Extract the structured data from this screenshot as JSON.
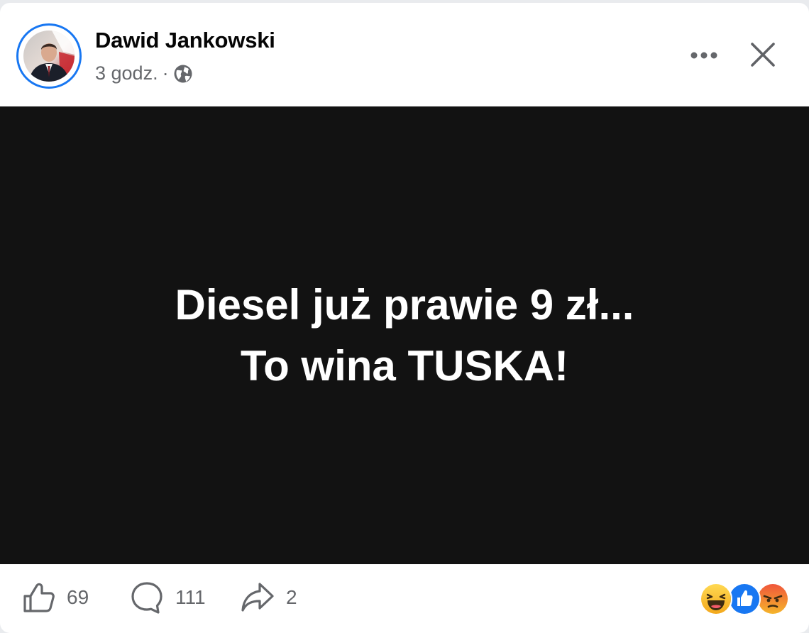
{
  "post": {
    "author_name": "Dawid Jankowski",
    "time": "3 godz.",
    "separator": "·",
    "visibility_icon": "globe-icon",
    "more_icon": "more-options-icon",
    "close_icon": "close-icon"
  },
  "media": {
    "line1": "Diesel już prawie 9 zł...",
    "line2": "To wina TUSKA!",
    "background": "#121212",
    "text_color": "#ffffff"
  },
  "actions": {
    "like": {
      "icon": "like-icon",
      "count": "69"
    },
    "comment": {
      "icon": "comment-icon",
      "count": "111"
    },
    "share": {
      "icon": "share-icon",
      "count": "2"
    }
  },
  "reactions": [
    "haha-icon",
    "like-reaction-icon",
    "angry-icon"
  ],
  "colors": {
    "accent": "#1877f2",
    "secondary_text": "#65676b",
    "primary_text": "#050505"
  }
}
